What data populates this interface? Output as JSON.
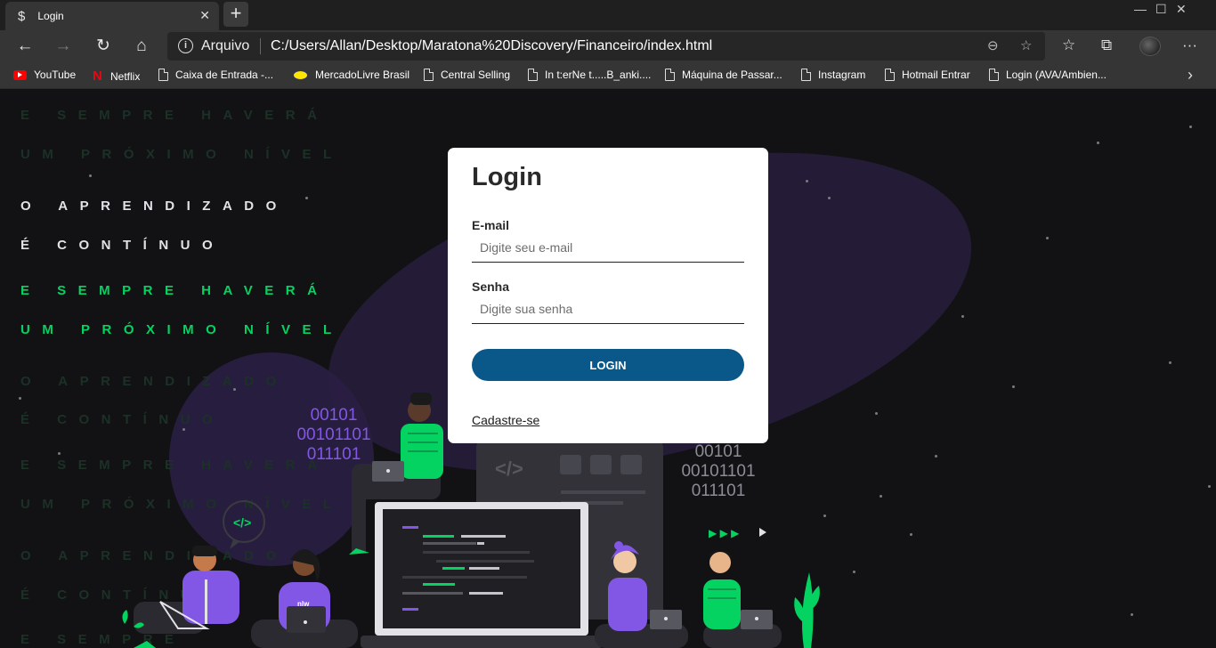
{
  "browser": {
    "tab": {
      "favicon": "$",
      "title": "Login",
      "close": "✕"
    },
    "new_tab": "+",
    "window_controls": {
      "minimize": "—",
      "maximize": "☐",
      "close": "✕"
    },
    "nav": {
      "back": "←",
      "forward": "→",
      "reload": "↻",
      "home": "⌂"
    },
    "address": {
      "info": "i",
      "label": "Arquivo",
      "url": "C:/Users/Allan/Desktop/Maratona%20Discovery/Financeiro/index.html"
    },
    "toolbar_icons": {
      "zoom": "⊖",
      "favorite_add": "☆",
      "favorites": "☆",
      "collections": "⧉",
      "more": "···"
    },
    "bookmarks": [
      {
        "label": "YouTube",
        "icon": "youtube-icon"
      },
      {
        "label": "Netflix",
        "icon": "netflix-icon"
      },
      {
        "label": "Caixa de Entrada -...",
        "icon": "page-icon"
      },
      {
        "label": "MercadoLivre Brasil",
        "icon": "mercadolivre-icon"
      },
      {
        "label": "Central Selling",
        "icon": "page-icon"
      },
      {
        "label": "In t:erNe t.....B_anki....",
        "icon": "page-icon"
      },
      {
        "label": "Máquina de Passar...",
        "icon": "page-icon"
      },
      {
        "label": "Instagram",
        "icon": "page-icon"
      },
      {
        "label": "Hotmail Entrar",
        "icon": "page-icon"
      },
      {
        "label": "Login (AVA/Ambien...",
        "icon": "page-icon"
      }
    ],
    "bookmarks_more": "›"
  },
  "background_text": {
    "rows": [
      {
        "text": "E SEMPRE HAVERÁ",
        "style": "faint"
      },
      {
        "text": "UM PRÓXIMO NÍVEL",
        "style": "faint"
      },
      {
        "text": "O APRENDIZADO",
        "style": "white"
      },
      {
        "text": "É CONTÍNUO",
        "style": "white"
      },
      {
        "text": "E SEMPRE HAVERÁ",
        "style": "green"
      },
      {
        "text": "UM PRÓXIMO NÍVEL",
        "style": "green"
      },
      {
        "text": "O APRENDIZADO",
        "style": "faint"
      },
      {
        "text": "É CONTÍNUO",
        "style": "faint"
      },
      {
        "text": "E SEMPRE HAVERÁ",
        "style": "faint"
      },
      {
        "text": "UM PRÓXIMO NÍVEL",
        "style": "faint"
      },
      {
        "text": "O APRENDIZADO",
        "style": "faint"
      },
      {
        "text": "É CONTÍNUO",
        "style": "faint"
      },
      {
        "text": "E SEMPRE",
        "style": "faint"
      }
    ]
  },
  "illustration": {
    "binary_left": [
      "00101",
      "00101101",
      "011101"
    ],
    "binary_right": [
      "00101",
      "00101101",
      "011101"
    ],
    "code_bubble": "</>",
    "code_window_tag": "</>",
    "play_arrows": "▶ ▶ ▶",
    "laptop_sticker": "nlw"
  },
  "login": {
    "title": "Login",
    "email_label": "E-mail",
    "email_placeholder": "Digite seu e-mail",
    "email_value": "",
    "password_label": "Senha",
    "password_placeholder": "Digite sua senha",
    "password_value": "",
    "submit_label": "LOGIN",
    "register_link": "Cadastre-se"
  },
  "colors": {
    "page_bg": "#121214",
    "accent_green": "#04d361",
    "accent_purple": "#8257e5",
    "button_blue": "#0a5789"
  }
}
